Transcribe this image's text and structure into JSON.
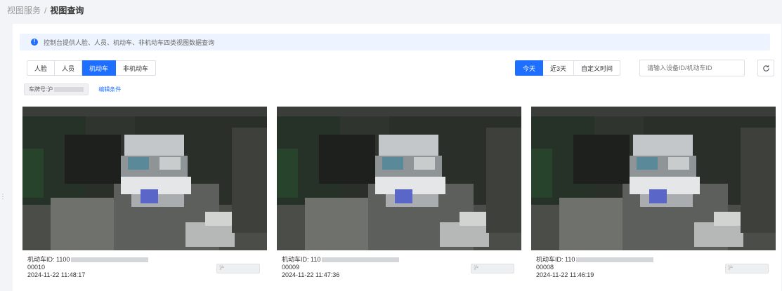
{
  "breadcrumb": {
    "parent": "视图服务",
    "separator": "/",
    "current": "视图查询"
  },
  "info": {
    "icon": "info-icon",
    "text": "控制台提供人脸、人员、机动车、非机动车四类视图数据查询"
  },
  "type_tabs": [
    {
      "label": "人脸",
      "active": false
    },
    {
      "label": "人员",
      "active": false
    },
    {
      "label": "机动车",
      "active": true
    },
    {
      "label": "非机动车",
      "active": false
    }
  ],
  "time_tabs": [
    {
      "label": "今天",
      "active": true
    },
    {
      "label": "近3天",
      "active": false
    },
    {
      "label": "自定义时间",
      "active": false
    }
  ],
  "search": {
    "placeholder": "请输入设备ID/机动车ID"
  },
  "condition": {
    "plate_label": "车牌号:沪",
    "edit_label": "编辑条件"
  },
  "cards": [
    {
      "id_label": "机动车ID: 1100",
      "seq": "00010",
      "time": "2024-11-22 11:48:17",
      "btn": "沪"
    },
    {
      "id_label": "机动车ID: 110",
      "seq": "00009",
      "time": "2024-11-22 11:47:36",
      "btn": "沪"
    },
    {
      "id_label": "机动车ID: 110",
      "seq": "00008",
      "time": "2024-11-22 11:46:19",
      "btn": "沪"
    }
  ],
  "colors": {
    "primary": "#1e6fff",
    "info_bg": "#eef4ff",
    "page_bg": "#f3f4f7"
  }
}
